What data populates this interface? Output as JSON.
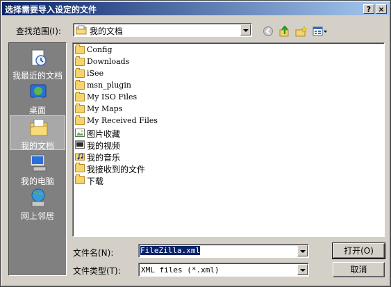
{
  "window": {
    "title": "选择需要导入设定的文件",
    "help_button": "?",
    "close_button": "×"
  },
  "lookin": {
    "label": "查找范围(I):",
    "value": "我的文档"
  },
  "places": [
    {
      "label": "我最近的文档",
      "icon": "recent-documents-icon"
    },
    {
      "label": "桌面",
      "icon": "desktop-icon"
    },
    {
      "label": "我的文档",
      "icon": "my-documents-icon",
      "selected": true
    },
    {
      "label": "我的电脑",
      "icon": "my-computer-icon"
    },
    {
      "label": "网上邻居",
      "icon": "network-places-icon"
    }
  ],
  "files": [
    {
      "name": "Config",
      "type": "folder"
    },
    {
      "name": "Downloads",
      "type": "folder"
    },
    {
      "name": "iSee",
      "type": "folder"
    },
    {
      "name": "msn_plugin",
      "type": "folder"
    },
    {
      "name": "My ISO Files",
      "type": "folder"
    },
    {
      "name": "My Maps",
      "type": "folder"
    },
    {
      "name": "My Received Files",
      "type": "folder"
    },
    {
      "name": "图片收藏",
      "type": "pictures-folder"
    },
    {
      "name": "我的视频",
      "type": "video-folder"
    },
    {
      "name": "我的音乐",
      "type": "music-folder"
    },
    {
      "name": "我接收到的文件",
      "type": "folder"
    },
    {
      "name": "下载",
      "type": "folder"
    }
  ],
  "filename": {
    "label": "文件名(N):",
    "value": "FileZilla.xml"
  },
  "filetype": {
    "label": "文件类型(T):",
    "value": "XML files (*.xml)"
  },
  "buttons": {
    "open": "打开(O)",
    "cancel": "取消"
  }
}
